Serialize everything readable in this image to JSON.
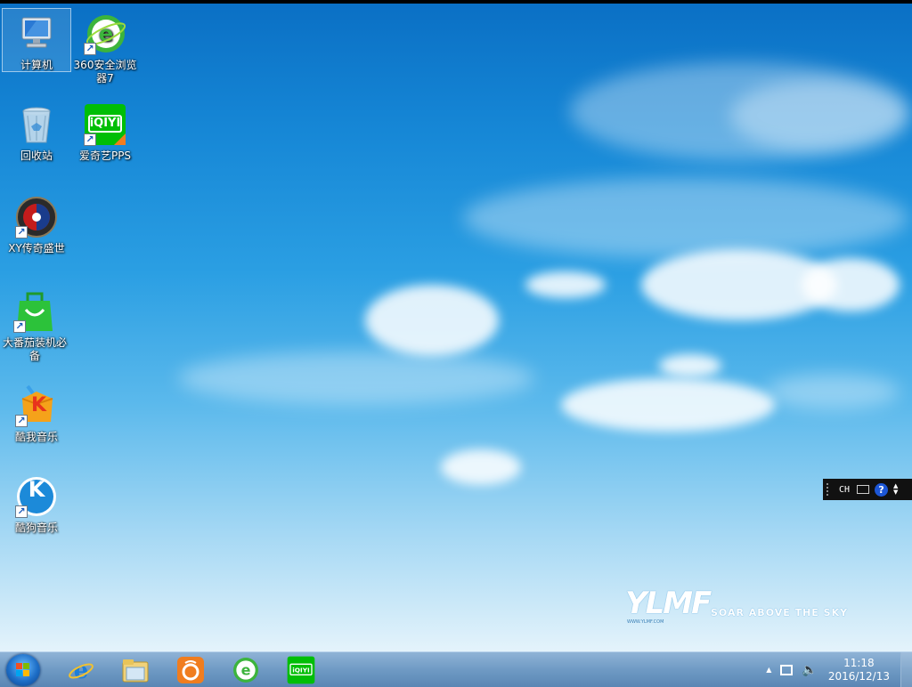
{
  "desktop_icons": [
    {
      "id": "computer",
      "label": "计算机",
      "icon": "computer-icon",
      "shortcut": false,
      "selected": true
    },
    {
      "id": "browser-360",
      "label": "360安全浏览器7",
      "icon": "360-browser-icon",
      "shortcut": true
    },
    {
      "id": "recycle-bin",
      "label": "回收站",
      "icon": "recycle-bin-icon",
      "shortcut": false
    },
    {
      "id": "iqiyi",
      "label": "爱奇艺PPS",
      "icon": "iqiyi-icon",
      "shortcut": true,
      "logo_text": "iQIYI"
    },
    {
      "id": "xy-game",
      "label": "XY传奇盛世",
      "icon": "xy-game-icon",
      "shortcut": true
    },
    {
      "id": "dafan",
      "label": "大番茄装机必备",
      "icon": "shopping-bag-icon",
      "shortcut": true
    },
    {
      "id": "kuwo",
      "label": "酷我音乐",
      "icon": "kuwo-music-icon",
      "shortcut": true,
      "logo_text": "K"
    },
    {
      "id": "kugou",
      "label": "酷狗音乐",
      "icon": "kugou-music-icon",
      "shortcut": true,
      "logo_text": "K"
    }
  ],
  "logo": {
    "letters": "YLMF",
    "slogan": "SOAR ABOVE THE SKY",
    "url": "WWW.YLMF.COM"
  },
  "language_bar": {
    "language": "CH",
    "help": "?"
  },
  "taskbar": {
    "pinned": [
      {
        "name": "ie-icon",
        "glyph": "e"
      },
      {
        "name": "explorer-icon",
        "glyph": ""
      },
      {
        "name": "uc-browser-icon",
        "glyph": ""
      },
      {
        "name": "360-browser-icon",
        "glyph": "e"
      },
      {
        "name": "iqiyi-icon",
        "glyph": "iQIYI"
      }
    ],
    "clock": {
      "time": "11:18",
      "date": "2016/12/13"
    }
  },
  "colors": {
    "sky_top": "#0a6fc4",
    "sky_bottom": "#e4f3fb",
    "taskbar": "#6f9ac4",
    "iqiyi_green": "#00be06",
    "help_blue": "#1c56d6"
  }
}
